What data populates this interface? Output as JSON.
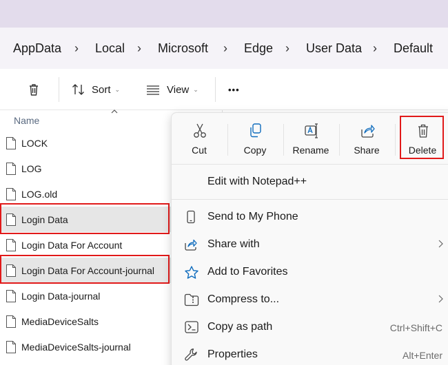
{
  "breadcrumb": [
    "AppData",
    "Local",
    "Microsoft",
    "Edge",
    "User Data",
    "Default"
  ],
  "toolbar": {
    "sort_label": "Sort",
    "view_label": "View",
    "more_label": "•••"
  },
  "column_header": "Name",
  "files": [
    {
      "name": "LOCK",
      "selected": false
    },
    {
      "name": "LOG",
      "selected": false
    },
    {
      "name": "LOG.old",
      "selected": false
    },
    {
      "name": "Login Data",
      "selected": true
    },
    {
      "name": "Login Data For Account",
      "selected": false
    },
    {
      "name": "Login Data For Account-journal",
      "selected": true
    },
    {
      "name": "Login Data-journal",
      "selected": false
    },
    {
      "name": "MediaDeviceSalts",
      "selected": false
    },
    {
      "name": "MediaDeviceSalts-journal",
      "selected": false
    }
  ],
  "context_menu": {
    "quick_actions": [
      {
        "label": "Cut",
        "icon": "scissors-icon"
      },
      {
        "label": "Copy",
        "icon": "copy-icon"
      },
      {
        "label": "Rename",
        "icon": "rename-icon"
      },
      {
        "label": "Share",
        "icon": "share-icon"
      },
      {
        "label": "Delete",
        "icon": "trash-icon"
      }
    ],
    "items": [
      {
        "label": "Edit with Notepad++",
        "icon": "",
        "shortcut": "",
        "submenu": false
      },
      {
        "label": "Send to My Phone",
        "icon": "phone-icon",
        "shortcut": "",
        "submenu": false
      },
      {
        "label": "Share with",
        "icon": "share-with-icon",
        "shortcut": "",
        "submenu": true
      },
      {
        "label": "Add to Favorites",
        "icon": "star-icon",
        "shortcut": "",
        "submenu": false
      },
      {
        "label": "Compress to...",
        "icon": "zip-folder-icon",
        "shortcut": "",
        "submenu": true
      },
      {
        "label": "Copy as path",
        "icon": "copy-path-icon",
        "shortcut": "Ctrl+Shift+C",
        "submenu": false
      },
      {
        "label": "Properties",
        "icon": "wrench-icon",
        "shortcut": "Alt+Enter",
        "submenu": false
      }
    ]
  },
  "colors": {
    "highlight": "#e11919",
    "selection": "#e6e6e6",
    "accent": "#0f6cbd",
    "titlebar": "#e3dcec"
  }
}
